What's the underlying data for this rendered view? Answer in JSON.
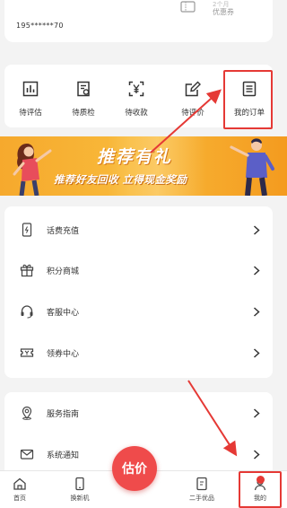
{
  "profile": {
    "phone": "195******70",
    "coupon_count": "2个月",
    "coupon_label": "优惠券"
  },
  "orders": [
    {
      "label": "待评估",
      "icon": "chart-icon"
    },
    {
      "label": "待质检",
      "icon": "inspect-icon"
    },
    {
      "label": "待收款",
      "icon": "yen-icon"
    },
    {
      "label": "待评价",
      "icon": "edit-icon"
    },
    {
      "label": "我的订单",
      "icon": "list-icon"
    }
  ],
  "banner": {
    "title": "推荐有礼",
    "subtitle": "推荐好友回收 立得现金奖励"
  },
  "menu": [
    {
      "label": "话费充值",
      "icon": "phone-recharge-icon"
    },
    {
      "label": "积分商城",
      "icon": "gift-icon"
    },
    {
      "label": "客服中心",
      "icon": "headset-icon"
    },
    {
      "label": "领券中心",
      "icon": "ticket-icon"
    }
  ],
  "menu2": [
    {
      "label": "服务指南",
      "icon": "location-icon"
    },
    {
      "label": "系统通知",
      "icon": "mail-icon"
    }
  ],
  "bottom_nav": {
    "home": "首页",
    "trade_in": "换新机",
    "estimate": "估价",
    "secondhand": "二手优品",
    "mine": "我的"
  },
  "colors": {
    "accent": "#e53935",
    "fab": "#ef4b4b",
    "banner": "#f6a92d"
  }
}
